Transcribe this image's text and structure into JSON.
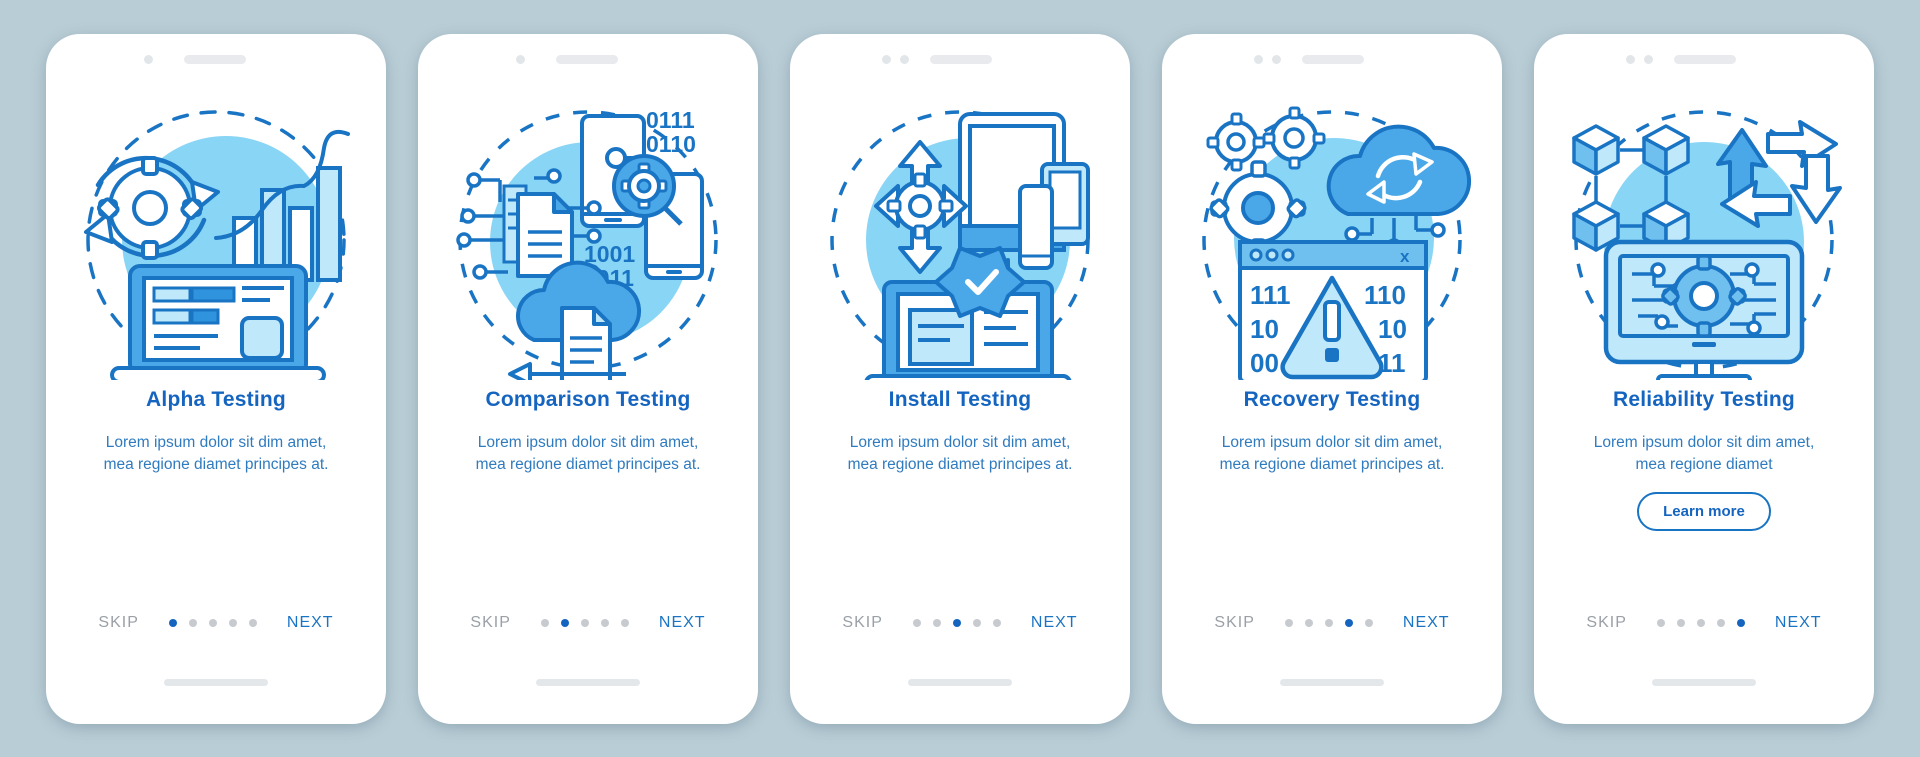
{
  "page": {
    "background_color": "#b9cdd6",
    "accent_color": "#1565c0",
    "illustration_fill": "#89d5f5",
    "muted_color": "#9aa0a6"
  },
  "common": {
    "skip_label": "SKIP",
    "next_label": "NEXT",
    "description": "Lorem ipsum dolor sit dim amet, mea regione diamet principes at.",
    "description_short": "Lorem ipsum dolor sit dim amet, mea regione diamet",
    "dot_count": 5
  },
  "screens": [
    {
      "title": "Alpha Testing",
      "description": "Lorem ipsum dolor sit dim amet, mea regione diamet principes at.",
      "active_dot": 1,
      "skip_label": "SKIP",
      "next_label": "NEXT",
      "illustration": "gear-refresh-bar-chart-laptop-dashboard",
      "status_bar_variant": "a",
      "has_learn_more": false
    },
    {
      "title": "Comparison Testing",
      "description": "Lorem ipsum dolor sit dim amet, mea regione diamet principes at.",
      "active_dot": 2,
      "skip_label": "SKIP",
      "next_label": "NEXT",
      "illustration": "phones-binary-cloud-document-nodes",
      "status_bar_variant": "a",
      "has_learn_more": false,
      "binary_top": [
        "0111",
        "0110"
      ],
      "binary_mid": [
        "1001",
        "0011"
      ]
    },
    {
      "title": "Install Testing",
      "description": "Lorem ipsum dolor sit dim amet, mea regione diamet principes at.",
      "active_dot": 3,
      "skip_label": "SKIP",
      "next_label": "NEXT",
      "illustration": "devices-arrows-gear-checkmark-laptop",
      "status_bar_variant": "b",
      "has_learn_more": false
    },
    {
      "title": "Recovery Testing",
      "description": "Lorem ipsum dolor sit dim amet, mea regione diamet principes at.",
      "active_dot": 4,
      "skip_label": "SKIP",
      "next_label": "NEXT",
      "illustration": "gears-cloud-browser-warning-binary",
      "status_bar_variant": "b",
      "has_learn_more": false,
      "binary_left": [
        "111",
        "10",
        "00"
      ],
      "binary_right": [
        "110",
        "10",
        "11"
      ],
      "window_close_label": "x"
    },
    {
      "title": "Reliability Testing",
      "description": "Lorem ipsum dolor sit dim amet, mea regione diamet",
      "active_dot": 5,
      "skip_label": "SKIP",
      "next_label": "NEXT",
      "learn_more_label": "Learn more",
      "illustration": "cubes-network-arrows-monitor-gear-circuit",
      "status_bar_variant": "b",
      "has_learn_more": true
    }
  ]
}
